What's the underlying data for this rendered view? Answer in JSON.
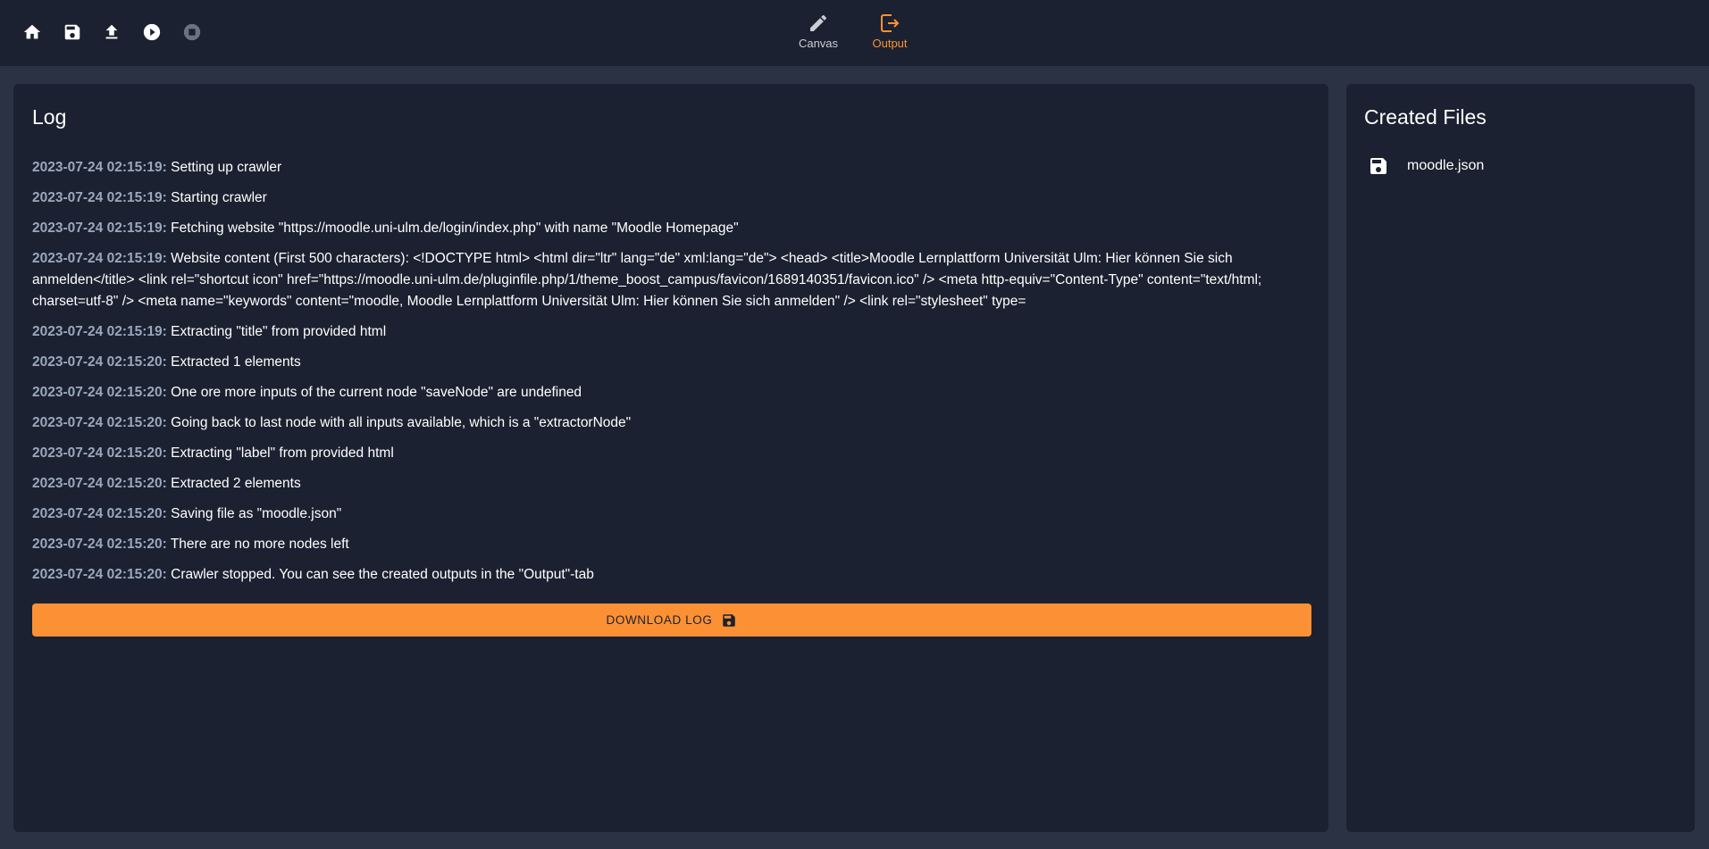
{
  "toolbar": {
    "buttons": [
      {
        "name": "home",
        "icon": "home-icon"
      },
      {
        "name": "save",
        "icon": "save-icon"
      },
      {
        "name": "upload",
        "icon": "upload-icon"
      },
      {
        "name": "run",
        "icon": "play-circle-icon"
      },
      {
        "name": "stop",
        "icon": "stop-circle-icon",
        "disabled": true
      }
    ]
  },
  "tabs": [
    {
      "label": "Canvas",
      "icon": "pencil-icon",
      "active": false
    },
    {
      "label": "Output",
      "icon": "exit-to-app-icon",
      "active": true
    }
  ],
  "colors": {
    "accent": "#fb9134",
    "background": "#2a3244",
    "panel": "#1b2130",
    "timestamp": "#9aa7bd"
  },
  "log": {
    "title": "Log",
    "entries": [
      {
        "timestamp": "2023-07-24 02:15:19:",
        "message": "Setting up crawler"
      },
      {
        "timestamp": "2023-07-24 02:15:19:",
        "message": "Starting crawler"
      },
      {
        "timestamp": "2023-07-24 02:15:19:",
        "message": "Fetching website \"https://moodle.uni-ulm.de/login/index.php\" with name \"Moodle Homepage\""
      },
      {
        "timestamp": "2023-07-24 02:15:19:",
        "message": "Website content (First 500 characters): <!DOCTYPE html> <html dir=\"ltr\" lang=\"de\" xml:lang=\"de\"> <head> <title>Moodle Lernplattform Universität Ulm: Hier können Sie sich anmelden</title> <link rel=\"shortcut icon\" href=\"https://moodle.uni-ulm.de/pluginfile.php/1/theme_boost_campus/favicon/1689140351/favicon.ico\" /> <meta http-equiv=\"Content-Type\" content=\"text/html; charset=utf-8\" /> <meta name=\"keywords\" content=\"moodle, Moodle Lernplattform Universität Ulm: Hier können Sie sich anmelden\" /> <link rel=\"stylesheet\" type="
      },
      {
        "timestamp": "2023-07-24 02:15:19:",
        "message": "Extracting \"title\" from provided html"
      },
      {
        "timestamp": "2023-07-24 02:15:20:",
        "message": "Extracted 1 elements"
      },
      {
        "timestamp": "2023-07-24 02:15:20:",
        "message": "One ore more inputs of the current node \"saveNode\" are undefined"
      },
      {
        "timestamp": "2023-07-24 02:15:20:",
        "message": "Going back to last node with all inputs available, which is a \"extractorNode\""
      },
      {
        "timestamp": "2023-07-24 02:15:20:",
        "message": "Extracting \"label\" from provided html"
      },
      {
        "timestamp": "2023-07-24 02:15:20:",
        "message": "Extracted 2 elements"
      },
      {
        "timestamp": "2023-07-24 02:15:20:",
        "message": "Saving file as \"moodle.json\""
      },
      {
        "timestamp": "2023-07-24 02:15:20:",
        "message": "There are no more nodes left"
      },
      {
        "timestamp": "2023-07-24 02:15:20:",
        "message": "Crawler stopped. You can see the created outputs in the \"Output\"-tab"
      }
    ],
    "download_label": "DOWNLOAD LOG",
    "download_icon": "save-icon"
  },
  "files": {
    "title": "Created Files",
    "items": [
      {
        "name": "moodle.json",
        "icon": "save-icon"
      }
    ]
  }
}
